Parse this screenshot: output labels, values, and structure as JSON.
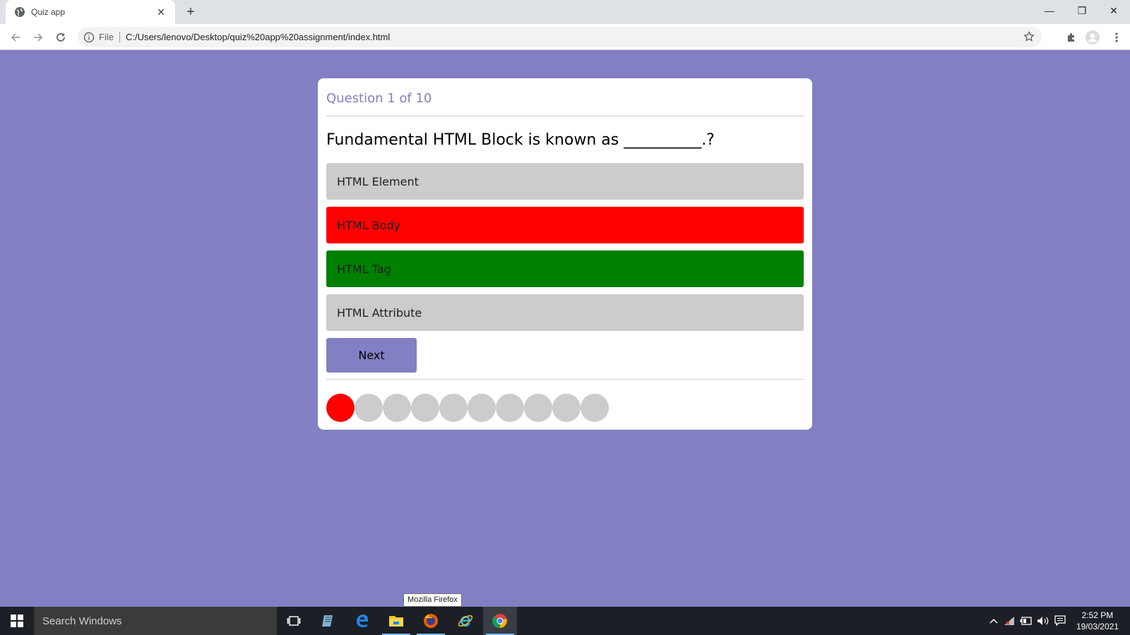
{
  "browser": {
    "tab_title": "Quiz app",
    "url_scheme": "File",
    "url": "C:/Users/lenovo/Desktop/quiz%20app%20assignment/index.html"
  },
  "quiz": {
    "counter": "Question 1 of 10",
    "question": "Fundamental HTML Block is known as __________.?",
    "options": [
      {
        "label": "HTML Element",
        "state": "neutral",
        "color": "#cccccc"
      },
      {
        "label": "HTML Body",
        "state": "wrong",
        "color": "#ff0000"
      },
      {
        "label": "HTML Tag",
        "state": "correct",
        "color": "#008000"
      },
      {
        "label": "HTML Attribute",
        "state": "neutral",
        "color": "#cccccc"
      }
    ],
    "next_label": "Next",
    "progress": {
      "total": 10,
      "states": [
        "wrong",
        "pending",
        "pending",
        "pending",
        "pending",
        "pending",
        "pending",
        "pending",
        "pending",
        "pending"
      ]
    },
    "colors": {
      "accent": "#8280c2",
      "wrong": "#ff0000",
      "correct": "#008000",
      "neutral": "#cccccc"
    }
  },
  "tooltip": "Mozilla Firefox",
  "taskbar": {
    "search_placeholder": "Search Windows",
    "time": "2:52 PM",
    "date": "19/03/2021"
  }
}
